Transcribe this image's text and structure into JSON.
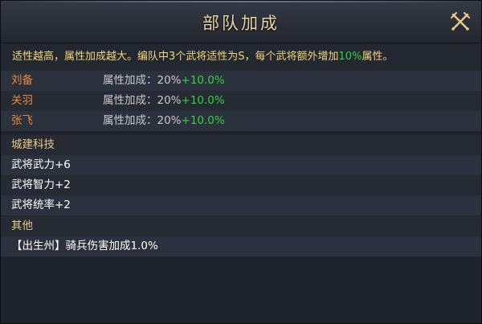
{
  "dialog": {
    "title": "部队加成"
  },
  "description": {
    "before": "适性越高，属性加成越大。编队中3个武将适性为S，每个武将额外增加",
    "highlight": "10%",
    "after": "属性。"
  },
  "generals": [
    {
      "name": "刘备",
      "attr_label": "属性加成：",
      "base": "20%",
      "bonus": "+10.0%"
    },
    {
      "name": "关羽",
      "attr_label": "属性加成：",
      "base": "20%",
      "bonus": "+10.0%"
    },
    {
      "name": "张飞",
      "attr_label": "属性加成：",
      "base": "20%",
      "bonus": "+10.0%"
    }
  ],
  "city_tech": {
    "heading": "城建科技",
    "items": [
      "武将武力+6",
      "武将智力+2",
      "武将统率+2"
    ]
  },
  "other": {
    "heading": "其他",
    "items": [
      "【出生州】骑兵伤害加成1.0%"
    ]
  },
  "colors": {
    "description_text": "#f0d77c",
    "bonus_green": "#33d13a",
    "general_name": "#e88a3c",
    "section_heading": "#e9c88a",
    "title_text": "#e9d3a6"
  },
  "icons": {
    "close": "crossed-swords-close-icon"
  }
}
